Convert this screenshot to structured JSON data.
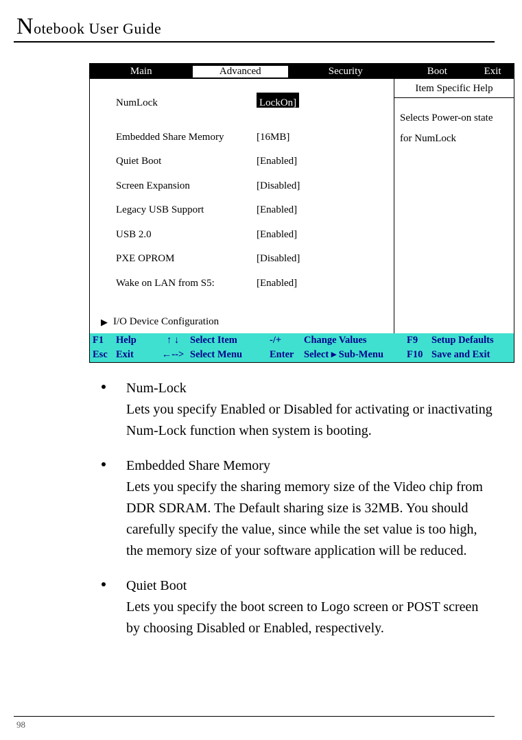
{
  "page": {
    "title": "Notebook User Guide",
    "number": "98"
  },
  "bios": {
    "tabs": {
      "main": "Main",
      "advanced": "Advanced",
      "security": "Security",
      "boot": "Boot",
      "exit": "Exit"
    },
    "help": {
      "title": "Item Specific Help",
      "line1": "Selects Power-on state",
      "line2": "for NumLock"
    },
    "settings": {
      "numlock": {
        "label": "NumLock",
        "value": "LockOn]"
      },
      "embshare": {
        "label": "Embedded Share Memory",
        "value": "[16MB]"
      },
      "quiet": {
        "label": "Quiet Boot",
        "value": "[Enabled]"
      },
      "screenexp": {
        "label": "Screen Expansion",
        "value": "[Disabled]"
      },
      "legacyusb": {
        "label": "Legacy USB Support",
        "value": "[Enabled]"
      },
      "usb20": {
        "label": "USB 2.0",
        "value": "[Enabled]"
      },
      "pxe": {
        "label": "PXE OPROM",
        "value": "[Disabled]"
      },
      "wol": {
        "label": "Wake on LAN from S5:",
        "value": "[Enabled]"
      }
    },
    "submenu": "I/O Device Configuration",
    "footer": {
      "r1": {
        "k1": "F1",
        "a1": "Help",
        "arr": "↑ ↓",
        "sel": "Select Item",
        "pm": "-/+",
        "chg": "Change Values",
        "k2": "F9",
        "a2": "Setup Defaults"
      },
      "r2": {
        "k1": "Esc",
        "a1": "Exit",
        "arr": "←-->",
        "sel": "Select Menu",
        "pm": "Enter",
        "chg": "Select  ▸ Sub-Menu",
        "k2": "F10",
        "a2": "Save and Exit"
      }
    }
  },
  "doc": {
    "items": {
      "numlock": {
        "title": "Num-Lock",
        "desc": "Lets you specify Enabled or Disabled for activating or inactivating Num-Lock function when system is booting."
      },
      "embshare": {
        "title": "Embedded Share Memory",
        "desc": "Lets you specify the sharing memory size of the Video chip from DDR SDRAM. The Default sharing size is 32MB. You should carefully specify the value, since while the set value is too high, the memory size of your software application will be reduced."
      },
      "quiet": {
        "title": "Quiet Boot",
        "desc": "Lets you specify the boot screen to Logo screen or POST screen by choosing Disabled or Enabled, respectively."
      }
    }
  }
}
